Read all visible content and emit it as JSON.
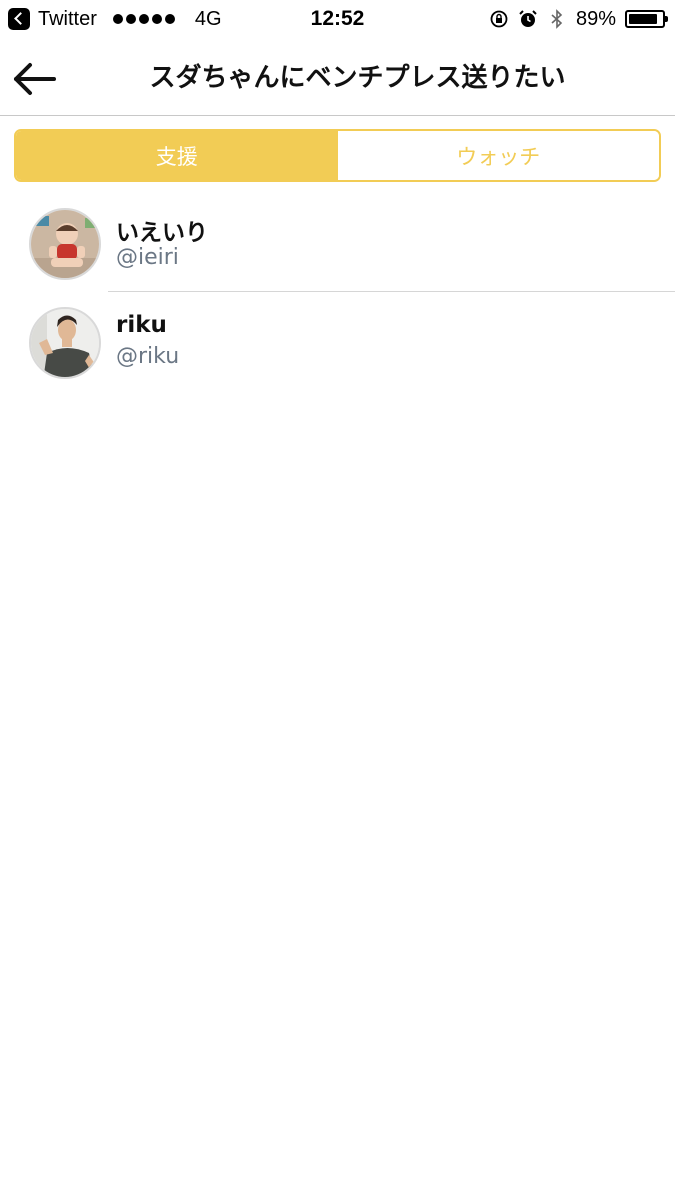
{
  "status_bar": {
    "back_app_label": "Twitter",
    "network": "4G",
    "time": "12:52",
    "battery": "89%",
    "battery_level": 0.89,
    "icons": [
      "rotation-lock-icon",
      "alarm-icon",
      "bluetooth-icon"
    ]
  },
  "nav": {
    "back_icon": "arrow-left-icon",
    "title": "スダちゃんにベンチプレス送りたい"
  },
  "tabs": [
    {
      "label": "支援",
      "active": true
    },
    {
      "label": "ウォッチ",
      "active": false
    }
  ],
  "users": [
    {
      "name": "いえいり",
      "handle": "@ieiri",
      "avatar": "baby-photo"
    },
    {
      "name": "riku",
      "handle": "@riku",
      "avatar": "man-photo"
    }
  ],
  "colors": {
    "accent": "#f2cc55",
    "handle_gray": "#6b7785"
  }
}
